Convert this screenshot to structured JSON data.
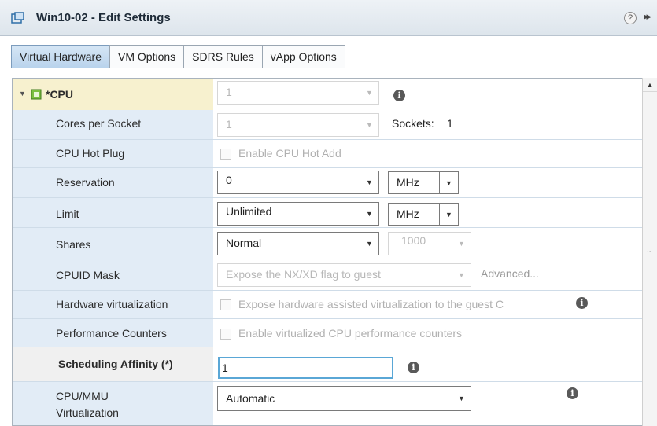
{
  "window": {
    "title": "Win10-02 - Edit Settings"
  },
  "icons": {
    "vm": "vm-icon",
    "help": "help-icon",
    "expand": "expand-panel-icon",
    "chip": "cpu-chip-icon"
  },
  "colors": {
    "accent": "#b9d3ec",
    "label_bg": "#e2ecf6",
    "cpu_row_bg": "#f7f1cf"
  },
  "tabs": [
    {
      "label": "Virtual Hardware",
      "active": true
    },
    {
      "label": "VM Options",
      "active": false
    },
    {
      "label": "SDRS Rules",
      "active": false
    },
    {
      "label": "vApp Options",
      "active": false
    }
  ],
  "cpu": {
    "label": "*CPU",
    "value": "1"
  },
  "rows": {
    "cores_per_socket": {
      "label": "Cores per Socket",
      "value": "1",
      "sockets_label": "Sockets:",
      "sockets_value": "1"
    },
    "hot_plug": {
      "label": "CPU Hot Plug",
      "checkbox_label": "Enable CPU Hot Add"
    },
    "reservation": {
      "label": "Reservation",
      "value": "0",
      "unit": "MHz"
    },
    "limit": {
      "label": "Limit",
      "value": "Unlimited",
      "unit": "MHz"
    },
    "shares": {
      "label": "Shares",
      "value": "Normal",
      "amount": "1000"
    },
    "cpuid_mask": {
      "label": "CPUID Mask",
      "value": "Expose the NX/XD flag to guest",
      "advanced": "Advanced..."
    },
    "hw_virt": {
      "label": "Hardware virtualization",
      "checkbox_label": "Expose hardware assisted virtualization to the guest C"
    },
    "perf_counters": {
      "label": "Performance Counters",
      "checkbox_label": "Enable virtualized CPU performance counters"
    },
    "sched_affinity": {
      "label": "Scheduling Affinity (*)",
      "value": "1"
    },
    "cpu_mmu": {
      "label_line1": "CPU/MMU",
      "label_line2": "Virtualization",
      "value": "Automatic"
    }
  }
}
